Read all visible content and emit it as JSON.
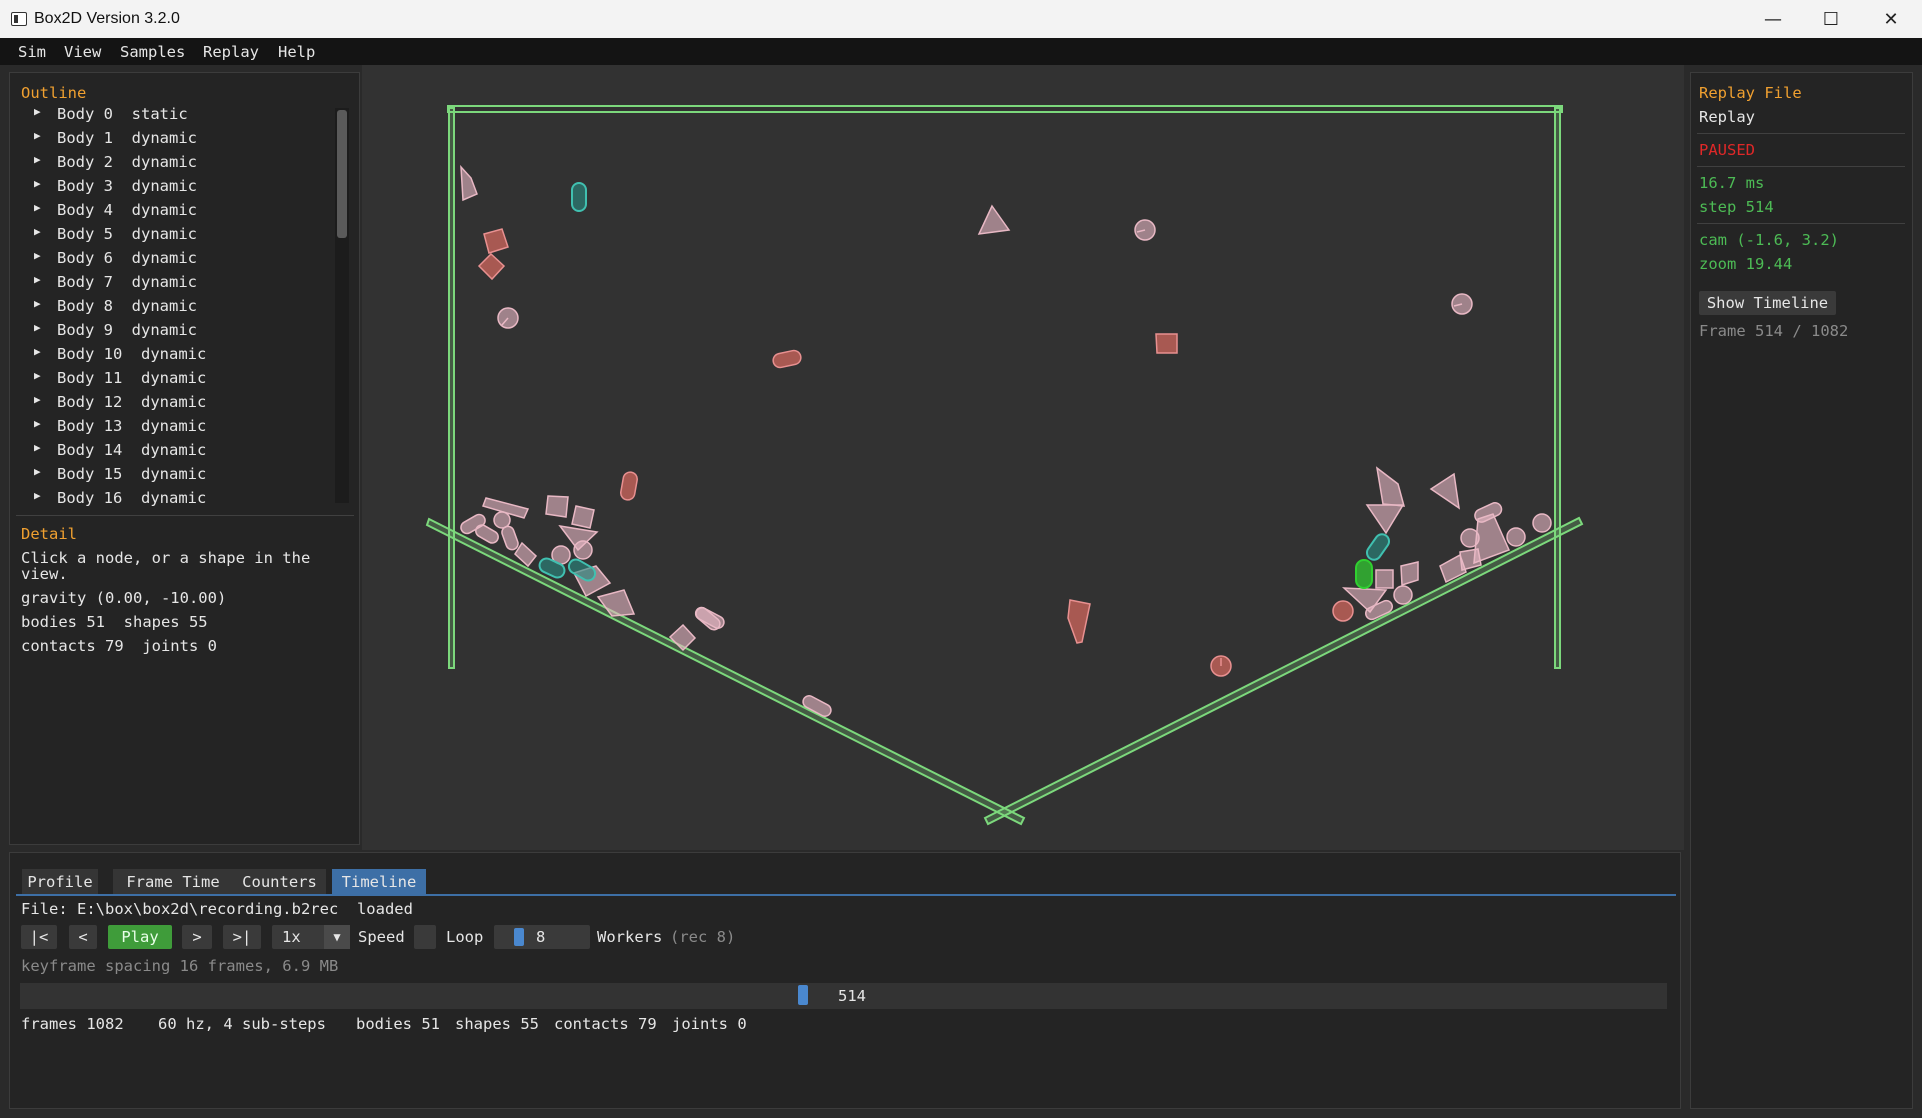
{
  "window": {
    "title": "Box2D Version 3.2.0",
    "minimize": "—",
    "maximize": "☐",
    "close": "✕"
  },
  "menu": [
    "Sim",
    "View",
    "Samples",
    "Replay",
    "Help"
  ],
  "outline": {
    "heading": "Outline",
    "bodies": [
      {
        "name": "Body 0",
        "type": "static"
      },
      {
        "name": "Body 1",
        "type": "dynamic"
      },
      {
        "name": "Body 2",
        "type": "dynamic"
      },
      {
        "name": "Body 3",
        "type": "dynamic"
      },
      {
        "name": "Body 4",
        "type": "dynamic"
      },
      {
        "name": "Body 5",
        "type": "dynamic"
      },
      {
        "name": "Body 6",
        "type": "dynamic"
      },
      {
        "name": "Body 7",
        "type": "dynamic"
      },
      {
        "name": "Body 8",
        "type": "dynamic"
      },
      {
        "name": "Body 9",
        "type": "dynamic"
      },
      {
        "name": "Body 10",
        "type": "dynamic"
      },
      {
        "name": "Body 11",
        "type": "dynamic"
      },
      {
        "name": "Body 12",
        "type": "dynamic"
      },
      {
        "name": "Body 13",
        "type": "dynamic"
      },
      {
        "name": "Body 14",
        "type": "dynamic"
      },
      {
        "name": "Body 15",
        "type": "dynamic"
      },
      {
        "name": "Body 16",
        "type": "dynamic"
      }
    ]
  },
  "detail": {
    "heading": "Detail",
    "hint_line1": "Click a node, or a shape in the",
    "hint_line2": "view.",
    "gravity": "gravity (0.00, -10.00)",
    "bodies_shapes": "bodies 51  shapes 55",
    "contacts_joints": "contacts 79  joints 0"
  },
  "replay_panel": {
    "heading": "Replay File",
    "subheading": "Replay",
    "status": "PAUSED",
    "frame_time": "16.7 ms",
    "step": "step 514",
    "cam": "cam (-1.6, 3.2)",
    "zoom": "zoom 19.44",
    "show_timeline": "Show Timeline",
    "frame": "Frame 514 / 1082"
  },
  "tabs": [
    "Profile",
    "Frame Time",
    "Counters",
    "Timeline"
  ],
  "active_tab": "Timeline",
  "timeline": {
    "file": "File: E:\\box\\box2d\\recording.b2rec  loaded",
    "btn_first": "|<",
    "btn_prev": "<",
    "btn_play": "Play",
    "btn_next": ">",
    "btn_last": ">|",
    "speed_value": "1x",
    "speed_label": "Speed",
    "loop_label": "Loop",
    "workers_value": "8",
    "workers_label": "Workers",
    "workers_rec": "(rec 8)",
    "keyframe_info": "keyframe spacing 16 frames, 6.9 MB",
    "current_frame": "514",
    "total_frames": 1082,
    "stats": {
      "frames": "frames 1082",
      "rate": "60 hz, 4 sub-steps",
      "bodies": "bodies 51",
      "shapes": "shapes 55",
      "contacts": "contacts 79",
      "joints": "joints 0"
    }
  },
  "colors": {
    "static_outline": "#7cd87c",
    "dynamic_awake": "#e89090",
    "dynamic_sleeping": "#e8b8c4",
    "kinematic": "#40c0b0",
    "selected": "#30d030",
    "accent": "#f0a030",
    "paused": "#e02828",
    "info": "#4dbb55"
  }
}
